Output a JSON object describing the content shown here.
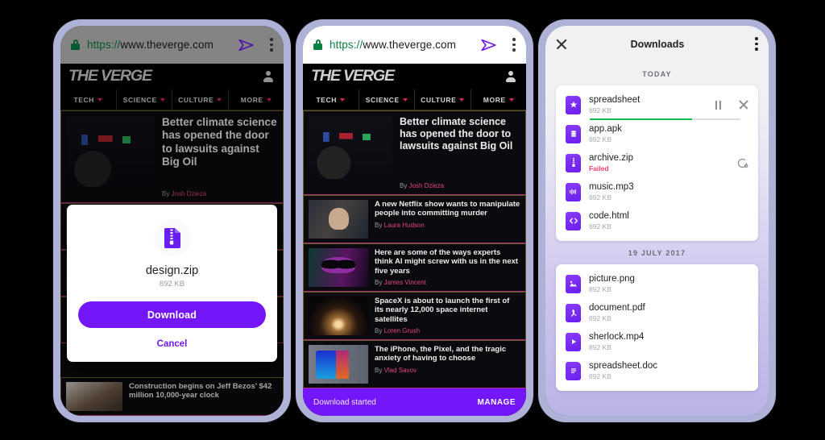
{
  "browser": {
    "url_scheme": "https://",
    "url_host": "www.theverge.com",
    "lock_icon": "lock-icon",
    "send_icon": "send-icon",
    "menu_icon": "kebab-menu-icon"
  },
  "site": {
    "logo": "THE VERGE",
    "account_icon": "person-icon",
    "nav": [
      {
        "label": "TECH"
      },
      {
        "label": "SCIENCE"
      },
      {
        "label": "CULTURE"
      },
      {
        "label": "MORE"
      }
    ],
    "articles": [
      {
        "headline": "Better climate science has opened the door to lawsuits against Big Oil",
        "by": "By ",
        "author": "Josh Dzieza",
        "art": "art-signs"
      },
      {
        "headline": "A new Netflix show wants to manipulate people into committing murder",
        "by": "By ",
        "author": "Laura Hudson",
        "art": "art-netflix"
      },
      {
        "headline": "Here are some of the ways experts think AI might screw with us in the next five years",
        "by": "By ",
        "author": "James Vincent",
        "art": "art-skull"
      },
      {
        "headline": "SpaceX is about to launch the first of its nearly 12,000 space internet satellites",
        "by": "By ",
        "author": "Loren Grush",
        "art": "art-rocket"
      },
      {
        "headline": "The iPhone, the Pixel, and the tragic anxiety of having to choose",
        "by": "By ",
        "author": "Vlad Savov",
        "art": "art-phones"
      },
      {
        "headline": "Construction begins on Jeff Bezos’ $42 million 10,000-year clock",
        "by": "By ",
        "author": "",
        "art": "art-dog"
      }
    ]
  },
  "dialog": {
    "file_icon": "zip-file-icon",
    "filename": "design.zip",
    "filesize": "892 KB",
    "download_label": "Download",
    "cancel_label": "Cancel"
  },
  "snackbar": {
    "message": "Download started",
    "action": "MANAGE"
  },
  "downloads": {
    "close_icon": "close-icon",
    "title": "Downloads",
    "menu_icon": "kebab-menu-icon",
    "groups": [
      {
        "label": "TODAY",
        "items": [
          {
            "name": "spreadsheet",
            "sub": "892 KB",
            "state": "downloading",
            "icon": "spreadsheet-file-icon",
            "glyph": "✸",
            "progress": 68
          },
          {
            "name": "app.apk",
            "sub": "892 KB",
            "state": "done",
            "icon": "apk-file-icon",
            "glyph": "☰"
          },
          {
            "name": "archive.zip",
            "sub": "Failed",
            "state": "failed",
            "icon": "zip-file-icon",
            "glyph": "⋮"
          },
          {
            "name": "music.mp3",
            "sub": "892 KB",
            "state": "done",
            "icon": "audio-file-icon",
            "glyph": "♫"
          },
          {
            "name": "code.html",
            "sub": "892 KB",
            "state": "done",
            "icon": "code-file-icon",
            "glyph": "‹›"
          }
        ]
      },
      {
        "label": "19 JULY 2017",
        "items": [
          {
            "name": "picture.png",
            "sub": "892 KB",
            "state": "done",
            "icon": "image-file-icon",
            "glyph": "▲"
          },
          {
            "name": "document.pdf",
            "sub": "892 KB",
            "state": "done",
            "icon": "pdf-file-icon",
            "glyph": "ᴘ"
          },
          {
            "name": "sherlock.mp4",
            "sub": "892 KB",
            "state": "done",
            "icon": "video-file-icon",
            "glyph": "▶"
          },
          {
            "name": "spreadsheet.doc",
            "sub": "892 KB",
            "state": "done",
            "icon": "doc-file-icon",
            "glyph": "≡"
          }
        ]
      }
    ],
    "pause_icon": "pause-icon",
    "cancel_icon": "close-icon",
    "retry_icon": "retry-icon"
  },
  "colors": {
    "accent_purple": "#7317f8",
    "progress_green": "#0fbb4d",
    "failed_red": "#ff3d6e",
    "lock_green": "#0b8043",
    "phone_frame": "#aeb2d6"
  }
}
